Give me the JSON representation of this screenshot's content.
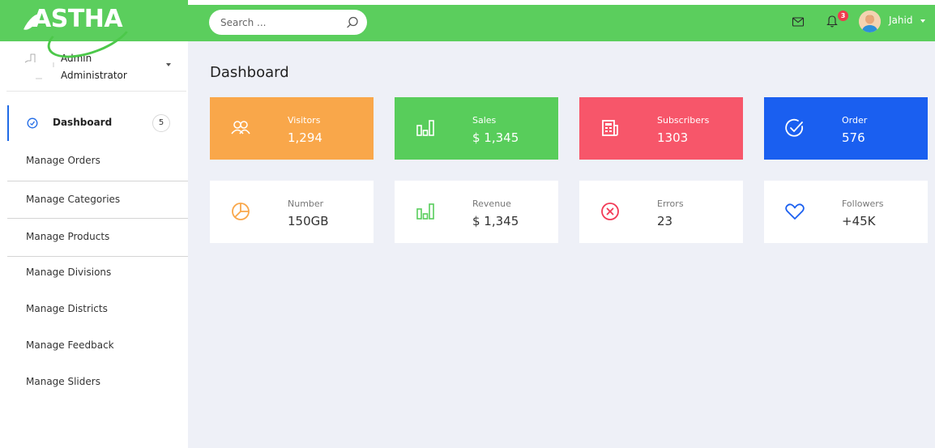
{
  "brand": {
    "name": "ASTHA",
    "accent": "#5bce5d"
  },
  "header": {
    "search": {
      "placeholder": "Search ...",
      "icon": "search-icon"
    },
    "icons": [
      "mail-icon",
      "bell-icon"
    ],
    "notifications_count": "3",
    "user": {
      "name": "Jahid"
    }
  },
  "sidebar": {
    "profile": {
      "name": "Admin",
      "role": "Administrator"
    },
    "active_item": {
      "label": "Dashboard",
      "badge": "5",
      "icon": "clock-icon"
    },
    "items": [
      {
        "label": "Manage Orders"
      },
      {
        "label": "Manage Categories"
      },
      {
        "label": "Manage Products"
      },
      {
        "label": "Manage Divisions"
      },
      {
        "label": "Manage Districts"
      },
      {
        "label": "Manage Feedback"
      },
      {
        "label": "Manage Sliders"
      }
    ]
  },
  "main": {
    "title": "Dashboard",
    "stat_cards": [
      {
        "label": "Visitors",
        "value": "1,294",
        "icon": "users-icon",
        "color": "#f9a74a"
      },
      {
        "label": "Sales",
        "value": "$ 1,345",
        "icon": "bar-chart-icon",
        "color": "#58cd5b"
      },
      {
        "label": "Subscribers",
        "value": "1303",
        "icon": "newspaper-icon",
        "color": "#f7566a"
      },
      {
        "label": "Order",
        "value": "576",
        "icon": "check-circle-icon",
        "color": "#1a5ff0"
      }
    ],
    "info_cards": [
      {
        "label": "Number",
        "value": "150GB",
        "icon": "pie-chart-icon",
        "icon_color": "#f9a74a"
      },
      {
        "label": "Revenue",
        "value": "$ 1,345",
        "icon": "bar-chart-icon",
        "icon_color": "#58cd5b"
      },
      {
        "label": "Errors",
        "value": "23",
        "icon": "x-circle-icon",
        "icon_color": "#f23a56"
      },
      {
        "label": "Followers",
        "value": "+45K",
        "icon": "heart-icon",
        "icon_color": "#1a5ff0"
      }
    ]
  }
}
